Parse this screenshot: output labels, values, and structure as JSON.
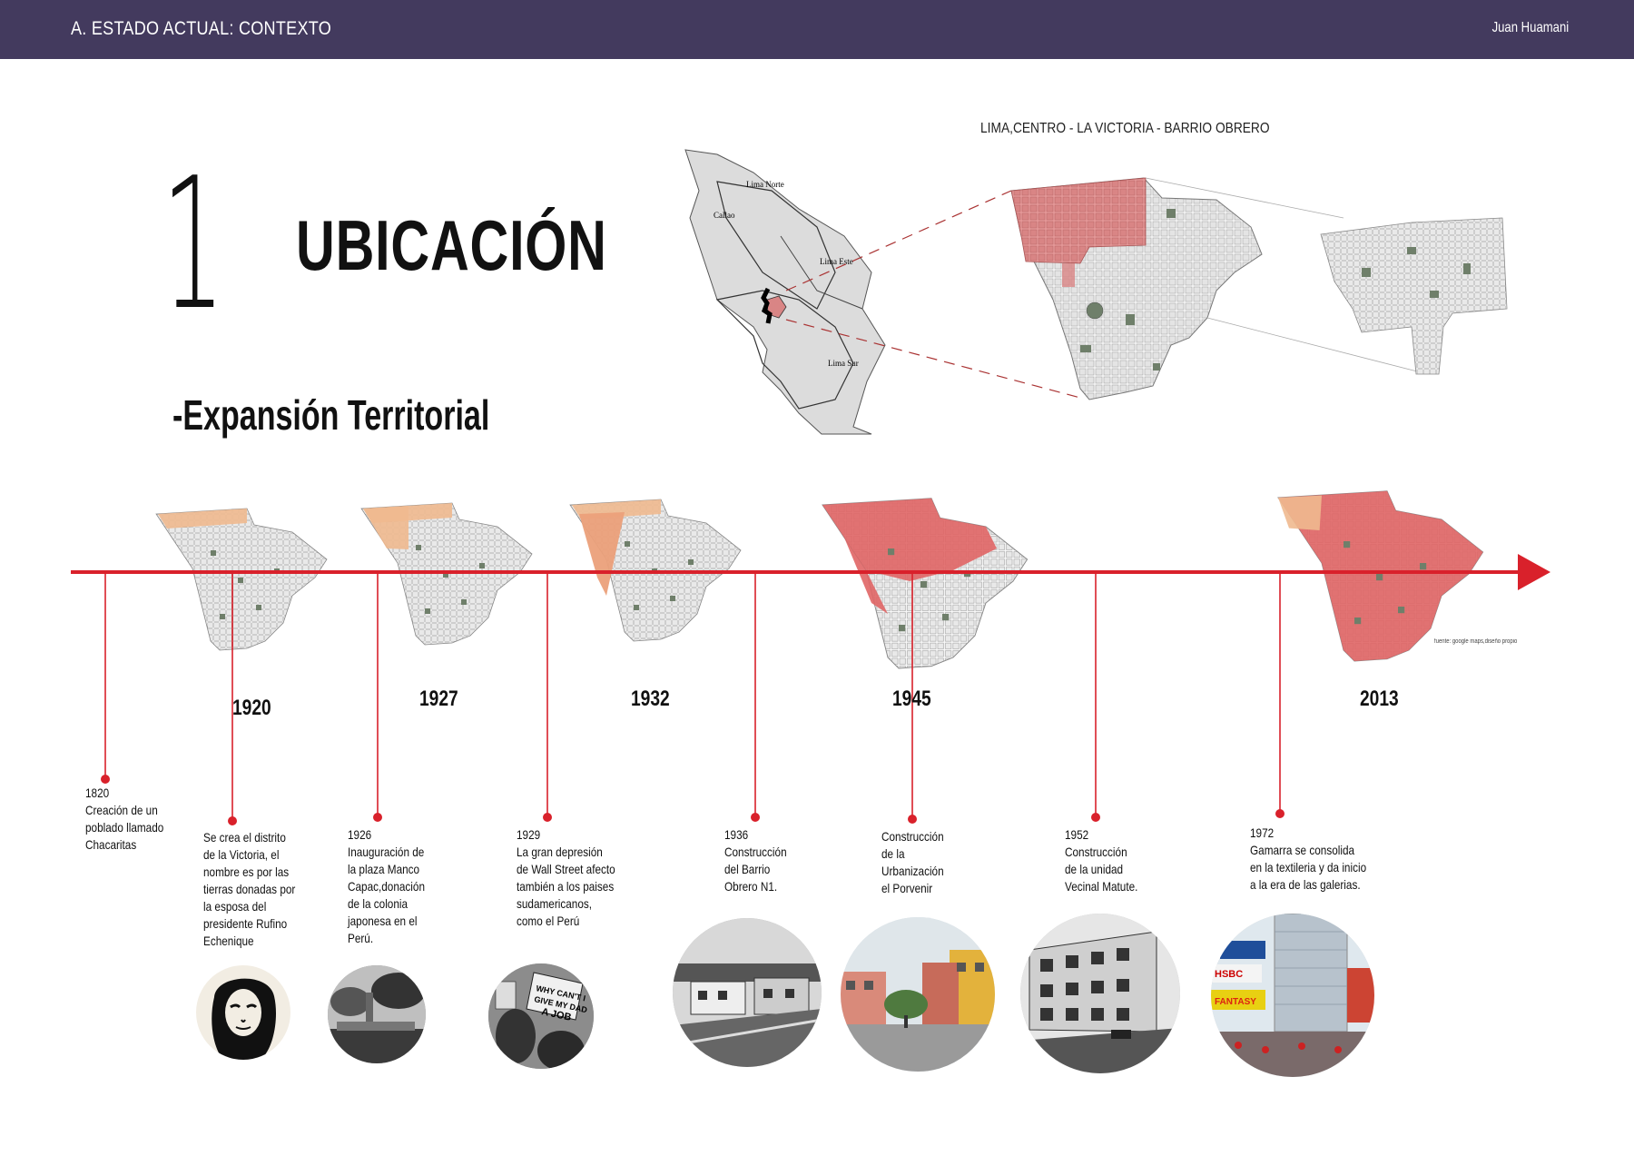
{
  "header": {
    "title": "A. ESTADO ACTUAL: CONTEXTO",
    "author": "Juan Huamani"
  },
  "section": {
    "number": "1",
    "title": "UBICACIÓN",
    "subtitle": "-Expansión Territorial"
  },
  "location_map": {
    "label": "LIMA,CENTRO - LA VICTORIA - BARRIO OBRERO",
    "districts": [
      "Lima Norte",
      "Callao",
      "Lima Este",
      "Lima Sur"
    ]
  },
  "map_source": "fuente: google maps,diseño propio",
  "expansion_years": [
    "1920",
    "1927",
    "1932",
    "1945",
    "2013"
  ],
  "timeline_events": [
    {
      "text": "1820\nCreación de un\npoblado llamado\nChacaritas"
    },
    {
      "text": "Se crea el distrito\nde la Victoria, el\nnombre es por las\ntierras donadas por\nla esposa del\npresidente Rufino\nEchenique"
    },
    {
      "text": "1926\nInauguración de\nla plaza Manco\nCapac,donación\nde la colonia\njaponesa en el\nPerú."
    },
    {
      "text": "1929\nLa gran depresión\nde Wall Street afecto\ntambién a los paises\nsudamericanos,\ncomo el Perú"
    },
    {
      "text": "1936\nConstrucción\ndel Barrio\nObrero N1."
    },
    {
      "text": "Construcción\nde la\nUrbanización\nel Porvenir"
    },
    {
      "text": "1952\nConstrucción\nde la unidad\nVecinal Matute."
    },
    {
      "text": "1972\nGamarra se consolida\nen la textileria y da inicio\n a la era de las  galerias."
    }
  ],
  "photos": [
    {
      "name": "portrait-photo",
      "sign_text": ""
    },
    {
      "name": "plaza-photo",
      "sign_text": ""
    },
    {
      "name": "protest-photo",
      "sign_text": "WHY CAN'T I GIVE MY DAD A JOB"
    },
    {
      "name": "barrio-obrero-photo",
      "sign_text": ""
    },
    {
      "name": "urbanizacion-photo",
      "sign_text": ""
    },
    {
      "name": "unidad-vecinal-photo",
      "sign_text": ""
    },
    {
      "name": "gamarra-photo",
      "sign_text": "HSBC FANTASY"
    }
  ],
  "colors": {
    "header": "#433a5e",
    "timeline": "#d9212b",
    "expansion_red": "#e06565",
    "expansion_orange": "#f0b98f",
    "block": "#eeeeee",
    "park": "#6f7f6a"
  }
}
